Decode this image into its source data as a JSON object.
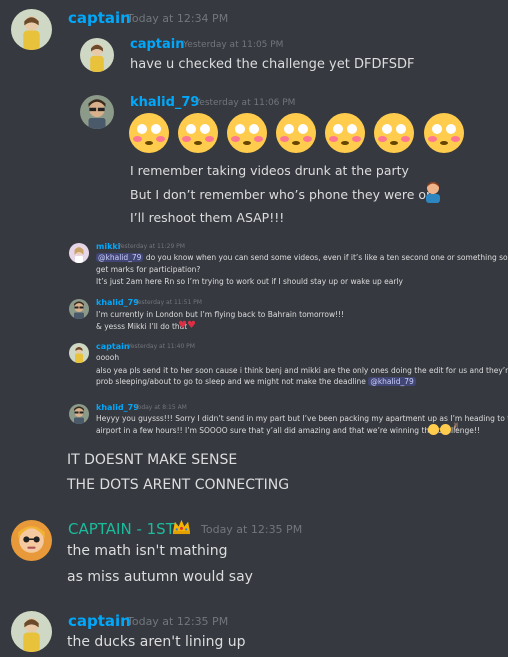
{
  "colors": {
    "bg": "#36393f",
    "captain": "#00a8fc",
    "khalid": "#00a8fc",
    "captain1st": "#1abc9c",
    "mikki": "#00a8fc",
    "mention_bg": "#414675"
  },
  "m1": {
    "author": "captain",
    "time": "Today at 12:34 PM"
  },
  "q1": {
    "author": "captain",
    "time": "Yesterday at 11:05 PM",
    "text": "have u checked the challenge yet DFDFSDF"
  },
  "q2": {
    "author": "khalid_79",
    "time": "Yesterday at 11:06 PM",
    "emoji_name": "flushed-face-icon",
    "lines": [
      "I remember taking videos drunk at the party",
      "But I don’t remember who’s phone they were on",
      "I’ll reshoot them ASAP!!!"
    ],
    "line2_emoji": "person-facepalming-icon"
  },
  "q3": {
    "author": "mikki",
    "time": "Yesterday at 11:29 PM",
    "mention": "@khalid_79",
    "text1": "do you know when you can send some videos, even if it’s like a ten second one or something so we",
    "text2": "get marks for participation?",
    "text3": "It’s just 2am here Rn so I’m trying to work out if I should stay up or wake up early"
  },
  "q4": {
    "author": "khalid_79",
    "time": "Yesterday at 11:51 PM",
    "text1": "I’m currently in London but I’m flying back to Bahrain tomorrow!!!",
    "text2": "& yesss Mikki I’ll do that"
  },
  "q5": {
    "author": "captain",
    "time": "Yesterday at 11:40 PM",
    "text1": "ooooh",
    "text2": "also yea pls send it to her soon cause i think benj and mikki are the only ones doing the edit for us and they’re",
    "text3": "prob sleeping/about to go to sleep and we might not make the deadline",
    "mention": "@khalid_79"
  },
  "q6": {
    "author": "khalid_79",
    "time": "Today at 8:15 AM",
    "text1": "Heyyy you guysss!!! Sorry I didn’t send in my part but I’ve been packing my apartment up as I’m heading to the",
    "text2": "airport in a few hours!! I’m SOOOO sure that y’all did amazing and that we’re winning this challenge!!"
  },
  "m1_lines": [
    "IT DOESNT MAKE SENSE",
    "THE DOTS ARENT CONNECTING"
  ],
  "m2": {
    "author": "CAPTAIN - 1ST",
    "time": "Today at 12:35 PM",
    "lines": [
      "the math isn't mathing",
      "as miss autumn would say"
    ]
  },
  "m3": {
    "author": "captain",
    "time": "Today at 12:35 PM",
    "lines": [
      "the ducks aren't lining up"
    ]
  }
}
